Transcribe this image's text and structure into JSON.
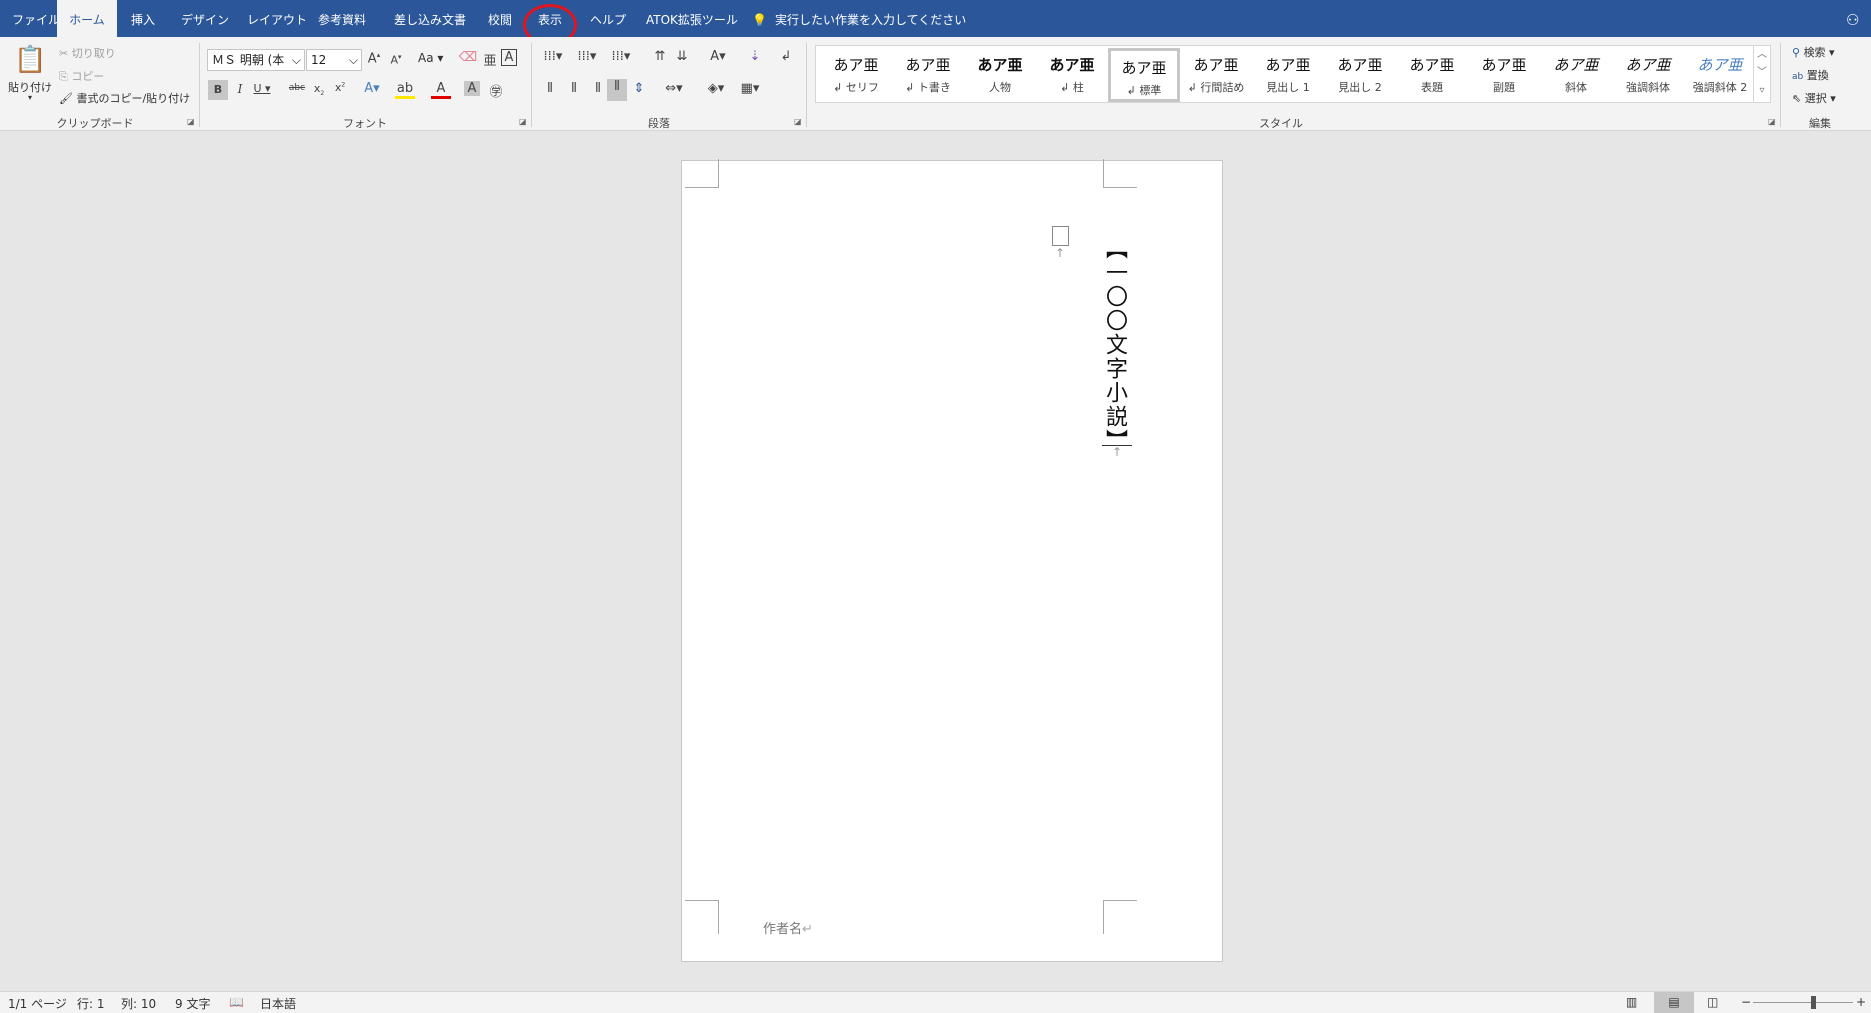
{
  "tabs": [
    {
      "label": "ファイル",
      "active": false
    },
    {
      "label": "ホーム",
      "active": true
    },
    {
      "label": "挿入",
      "active": false
    },
    {
      "label": "デザイン",
      "active": false
    },
    {
      "label": "レイアウト",
      "active": false
    },
    {
      "label": "参考資料",
      "active": false
    },
    {
      "label": "差し込み文書",
      "active": false
    },
    {
      "label": "校閲",
      "active": false
    },
    {
      "label": "表示",
      "active": false,
      "highlighted": true
    },
    {
      "label": "ヘルプ",
      "active": false
    },
    {
      "label": "ATOK拡張ツール",
      "active": false
    }
  ],
  "tell_me": {
    "icon": "lightbulb-icon",
    "placeholder": "実行したい作業を入力してください"
  },
  "share_icon": "person-add-icon",
  "highlight_color": "#e0151d",
  "accent_color": "#2b579a",
  "clipboard": {
    "label": "クリップボード",
    "paste": "貼り付け",
    "cut": "切り取り",
    "copy": "コピー",
    "format_painter": "書式のコピー/貼り付け"
  },
  "font": {
    "label": "フォント",
    "name": "ＭＳ 明朝 (本",
    "size": "12",
    "change_case": "Aa"
  },
  "paragraph": {
    "label": "段落"
  },
  "styles": {
    "label": "スタイル",
    "items": [
      {
        "preview": "あア亜",
        "name": "↲ セリフ"
      },
      {
        "preview": "あア亜",
        "name": "↲ ト書き"
      },
      {
        "preview": "あア亜",
        "name": "人物"
      },
      {
        "preview": "あア亜",
        "name": "↲ 柱"
      },
      {
        "preview": "あア亜",
        "name": "↲ 標準",
        "selected": true
      },
      {
        "preview": "あア亜",
        "name": "↲ 行間詰め"
      },
      {
        "preview": "あア亜",
        "name": "見出し 1"
      },
      {
        "preview": "あア亜",
        "name": "見出し 2"
      },
      {
        "preview": "あア亜",
        "name": "表題"
      },
      {
        "preview": "あア亜",
        "name": "副題"
      },
      {
        "preview": "あア亜",
        "name": "斜体"
      },
      {
        "preview": "あア亜",
        "name": "強調斜体"
      },
      {
        "preview": "あア亜",
        "name": "強調斜体 2"
      }
    ]
  },
  "editing": {
    "label": "編集",
    "find": "検索",
    "replace": "置換",
    "select": "選択"
  },
  "document": {
    "title": "【一〇〇文字小説】",
    "author": "作者名"
  },
  "status": {
    "page": "1/1 ページ",
    "line": "行: 1",
    "column": "列: 10",
    "chars": "9 文字",
    "language": "日本語"
  },
  "zoom": {
    "level_fraction": 0.5
  }
}
